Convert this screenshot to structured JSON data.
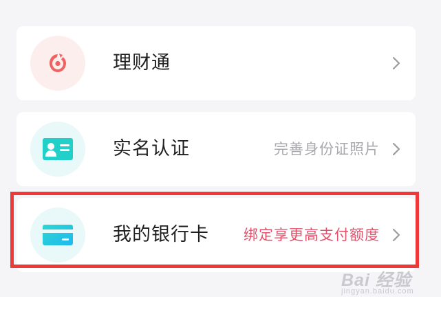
{
  "menu": {
    "items": [
      {
        "label": "理财通",
        "sub": "",
        "icon": "wealth-management-icon"
      },
      {
        "label": "实名认证",
        "sub": "完善身份证照片",
        "icon": "id-card-icon"
      },
      {
        "label": "我的银行卡",
        "sub": "绑定享更高支付额度",
        "icon": "bank-card-icon"
      }
    ]
  },
  "colors": {
    "page_bg": "#f5f5f7",
    "highlight_border": "#ef3838",
    "promo_text": "#e4516b",
    "secondary_text": "#a9a9ad",
    "icon_red": "#f0625f",
    "icon_cyan": "#22cfc9"
  },
  "watermark": {
    "brand": "Bai 经验",
    "url": "jingyan.baidu.com"
  }
}
